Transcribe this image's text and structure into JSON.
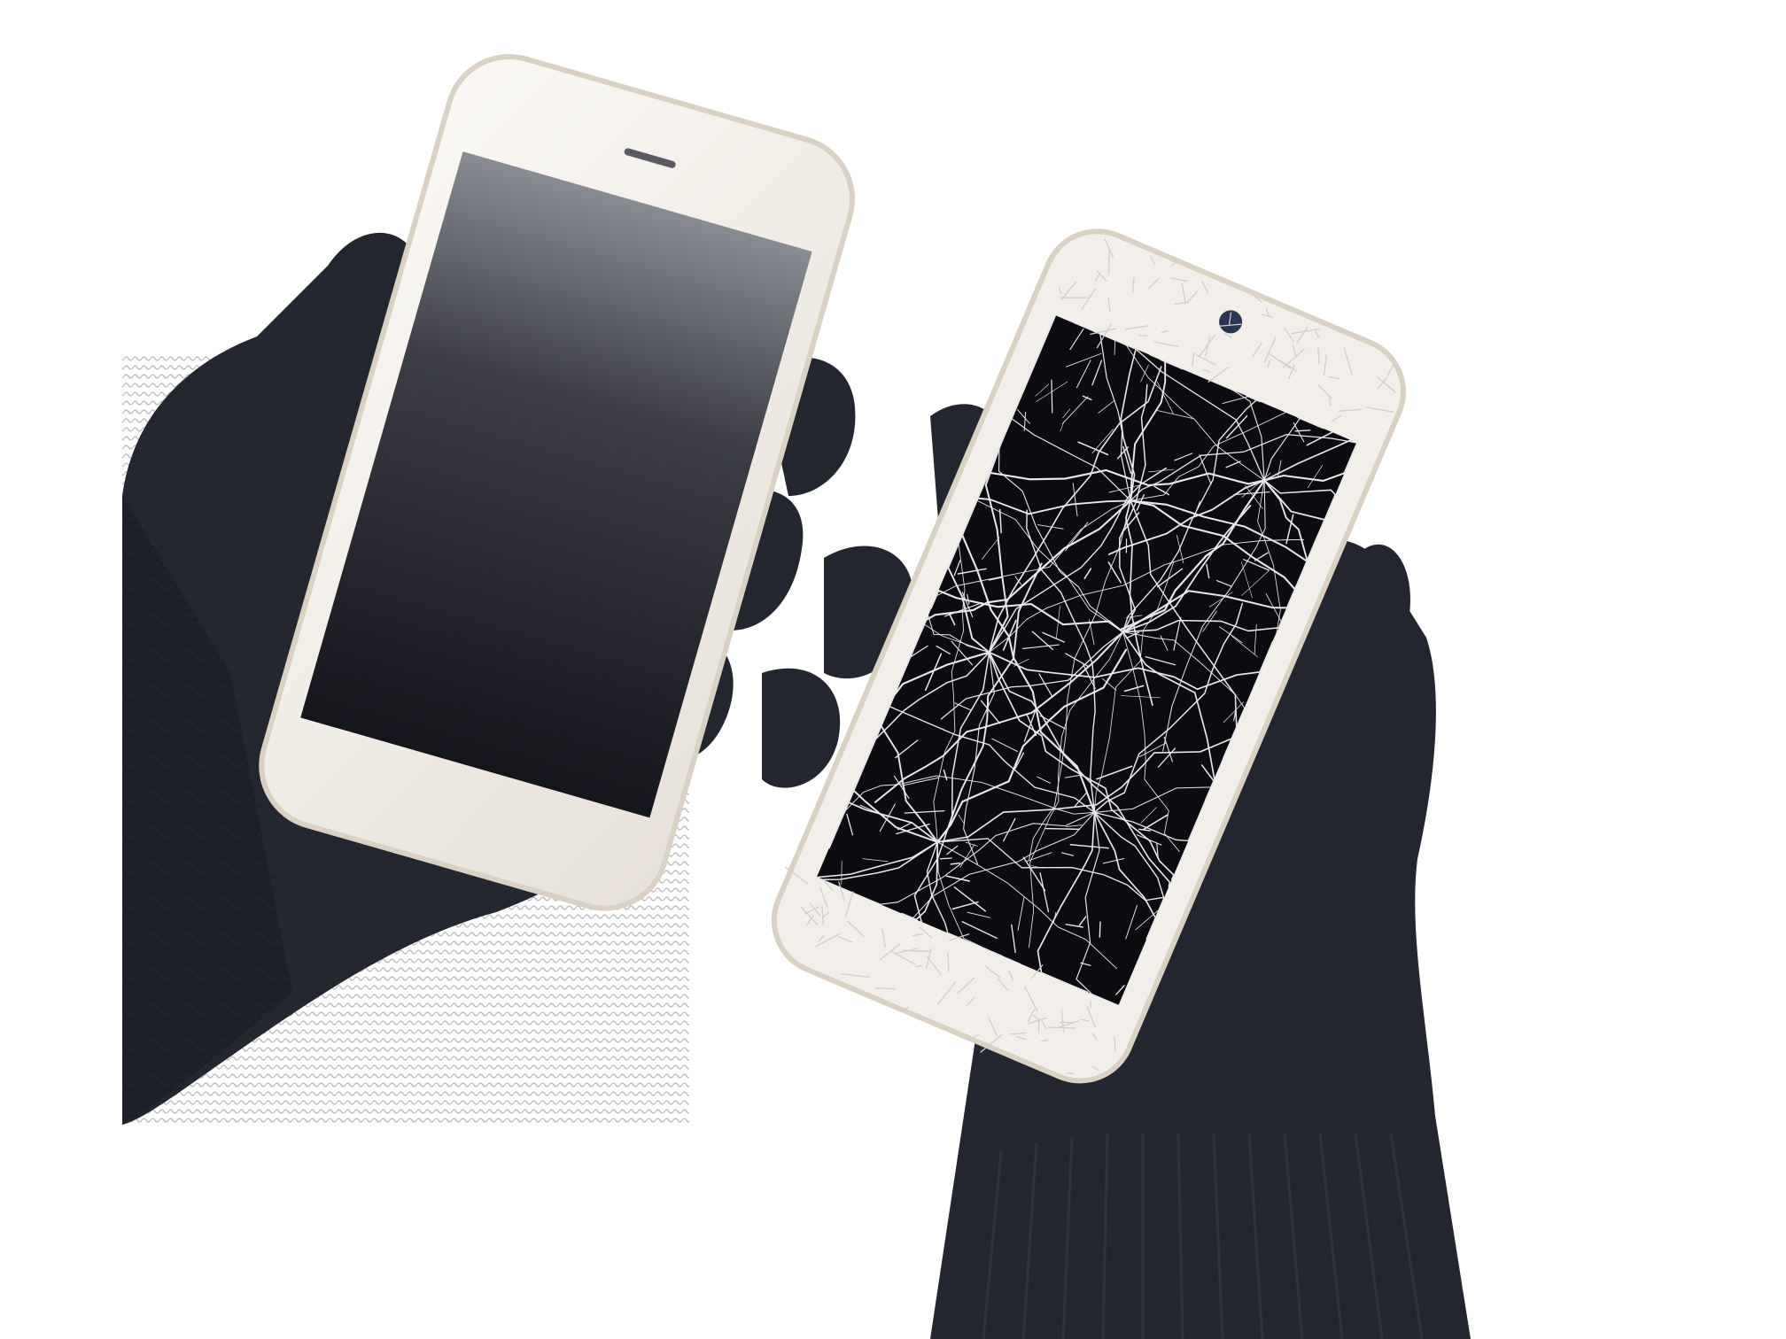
{
  "scene": {
    "background": "#ffffff",
    "glove_color": "#24262f",
    "glove_highlight": "#343744",
    "phone_body_color": "#f2efea",
    "phone_edge_color": "#d9d2c4",
    "intact_screen_top": "#8a8c93",
    "intact_screen_bottom": "#15151c",
    "broken_screen_color": "#0b0b10",
    "crack_color": "#e8e8ea"
  },
  "subjects": {
    "left": {
      "object": "smartphone",
      "screen_state": "intact",
      "hand": "left-glove"
    },
    "right": {
      "object": "smartphone",
      "screen_state": "shattered",
      "hand": "right-glove"
    }
  }
}
